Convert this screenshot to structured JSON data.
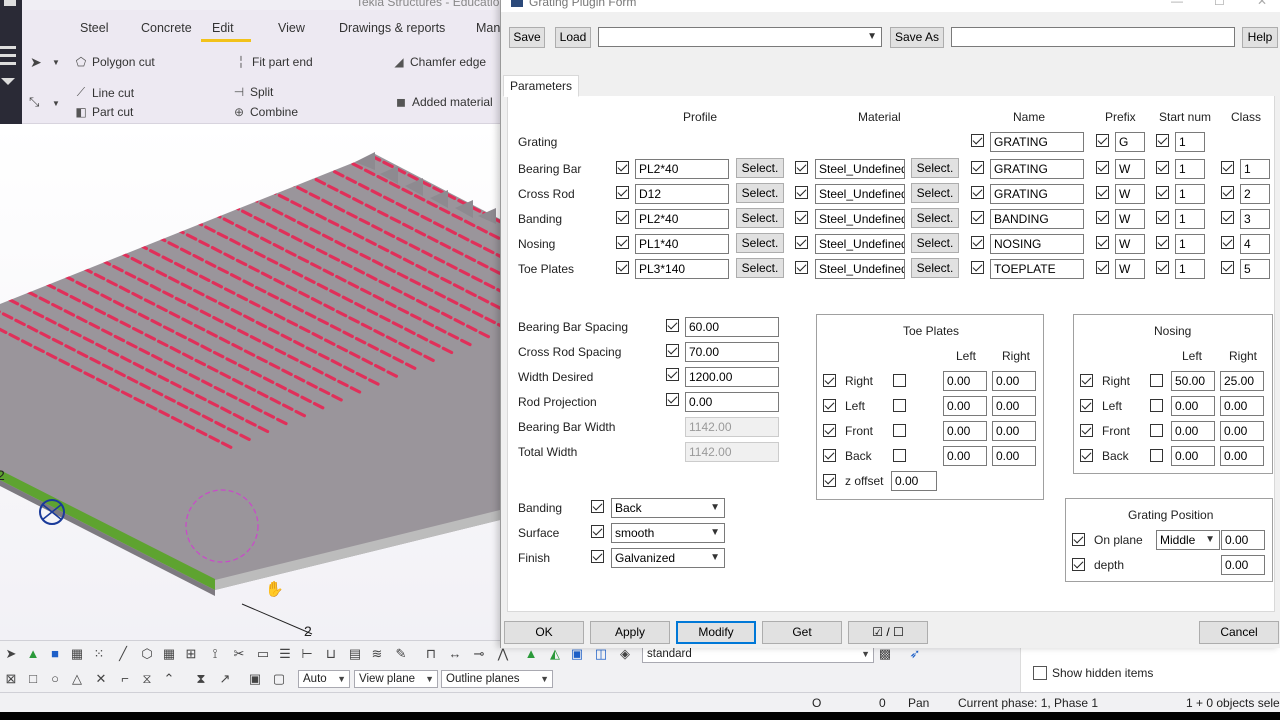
{
  "app": {
    "title": "Tekla Structures - Educatio",
    "tabs": [
      "Steel",
      "Concrete",
      "Edit",
      "View",
      "Drawings & reports",
      "Man"
    ],
    "active_tab": "Edit",
    "ribbon": {
      "polygon_cut": "Polygon cut",
      "fit_part_end": "Fit part end",
      "chamfer_edge": "Chamfer edge",
      "line_cut": "Line cut",
      "split": "Split",
      "part_cut": "Part cut",
      "combine": "Combine",
      "added_material": "Added material"
    },
    "viewport": {
      "axis_label_1": "2",
      "axis_label_2": "2"
    },
    "bottom_toolbar": {
      "view_combo": "standard",
      "snap_auto": "Auto",
      "view_plane": "View plane",
      "outline_planes": "Outline planes"
    },
    "right_panel": {
      "show_hidden_items": "Show hidden items",
      "show_hidden_checked": false
    },
    "status": {
      "o": "O",
      "zero": "0",
      "pan": "Pan",
      "phase": "Current phase: 1, Phase 1",
      "objects": "1 + 0 objects selec"
    }
  },
  "dialog": {
    "title": "Grating Plugin Form",
    "toolbar": {
      "save": "Save",
      "load": "Load",
      "load_value": "",
      "save_as": "Save As",
      "save_as_value": "",
      "help": "Help"
    },
    "tab": "Parameters",
    "columns": {
      "profile": "Profile",
      "material": "Material",
      "name": "Name",
      "prefix": "Prefix",
      "start_num": "Start num",
      "class": "Class"
    },
    "select_label": "Select.",
    "rows": [
      {
        "label": "Grating",
        "profile": null,
        "material": null,
        "name": "GRATING",
        "prefix": "G",
        "start": "1",
        "class": null
      },
      {
        "label": "Bearing Bar",
        "profile": "PL2*40",
        "material": "Steel_Undefined",
        "name": "GRATING",
        "prefix": "W",
        "start": "1",
        "class": "1"
      },
      {
        "label": "Cross Rod",
        "profile": "D12",
        "material": "Steel_Undefined",
        "name": "GRATING",
        "prefix": "W",
        "start": "1",
        "class": "2"
      },
      {
        "label": "Banding",
        "profile": "PL2*40",
        "material": "Steel_Undefined",
        "name": "BANDING",
        "prefix": "W",
        "start": "1",
        "class": "3"
      },
      {
        "label": "Nosing",
        "profile": "PL1*40",
        "material": "Steel_Undefined",
        "name": "NOSING",
        "prefix": "W",
        "start": "1",
        "class": "4"
      },
      {
        "label": "Toe Plates",
        "profile": "PL3*140",
        "material": "Steel_Undefined",
        "name": "TOEPLATE",
        "prefix": "W",
        "start": "1",
        "class": "5"
      }
    ],
    "spacing": {
      "bearing_bar_spacing_label": "Bearing Bar Spacing",
      "bearing_bar_spacing": "60.00",
      "cross_rod_spacing_label": "Cross Rod Spacing",
      "cross_rod_spacing": "70.00",
      "width_desired_label": "Width Desired",
      "width_desired": "1200.00",
      "rod_projection_label": "Rod Projection",
      "rod_projection": "0.00",
      "bearing_bar_width_label": "Bearing Bar Width",
      "bearing_bar_width": "1142.00",
      "total_width_label": "Total Width",
      "total_width": "1142.00"
    },
    "finish": {
      "banding_label": "Banding",
      "banding": "Back",
      "surface_label": "Surface",
      "surface": "smooth",
      "finish_label": "Finish",
      "finish": "Galvanized"
    },
    "toe_plates": {
      "title": "Toe Plates",
      "left_hdr": "Left",
      "right_hdr": "Right",
      "rows": [
        {
          "label": "Right",
          "left": "0.00",
          "right": "0.00"
        },
        {
          "label": "Left",
          "left": "0.00",
          "right": "0.00"
        },
        {
          "label": "Front",
          "left": "0.00",
          "right": "0.00"
        },
        {
          "label": "Back",
          "left": "0.00",
          "right": "0.00"
        }
      ],
      "z_offset_label": "z offset",
      "z_offset": "0.00"
    },
    "nosing": {
      "title": "Nosing",
      "left_hdr": "Left",
      "right_hdr": "Right",
      "rows": [
        {
          "label": "Right",
          "left": "50.00",
          "right": "25.00"
        },
        {
          "label": "Left",
          "left": "0.00",
          "right": "0.00"
        },
        {
          "label": "Front",
          "left": "0.00",
          "right": "0.00"
        },
        {
          "label": "Back",
          "left": "0.00",
          "right": "0.00"
        }
      ]
    },
    "grating_position": {
      "title": "Grating Position",
      "on_plane_label": "On plane",
      "on_plane": "Middle",
      "on_plane_value": "0.00",
      "depth_label": "depth",
      "depth": "0.00"
    },
    "footer": {
      "ok": "OK",
      "apply": "Apply",
      "modify": "Modify",
      "get": "Get",
      "toggle": "☑ / ☐",
      "cancel": "Cancel"
    }
  }
}
